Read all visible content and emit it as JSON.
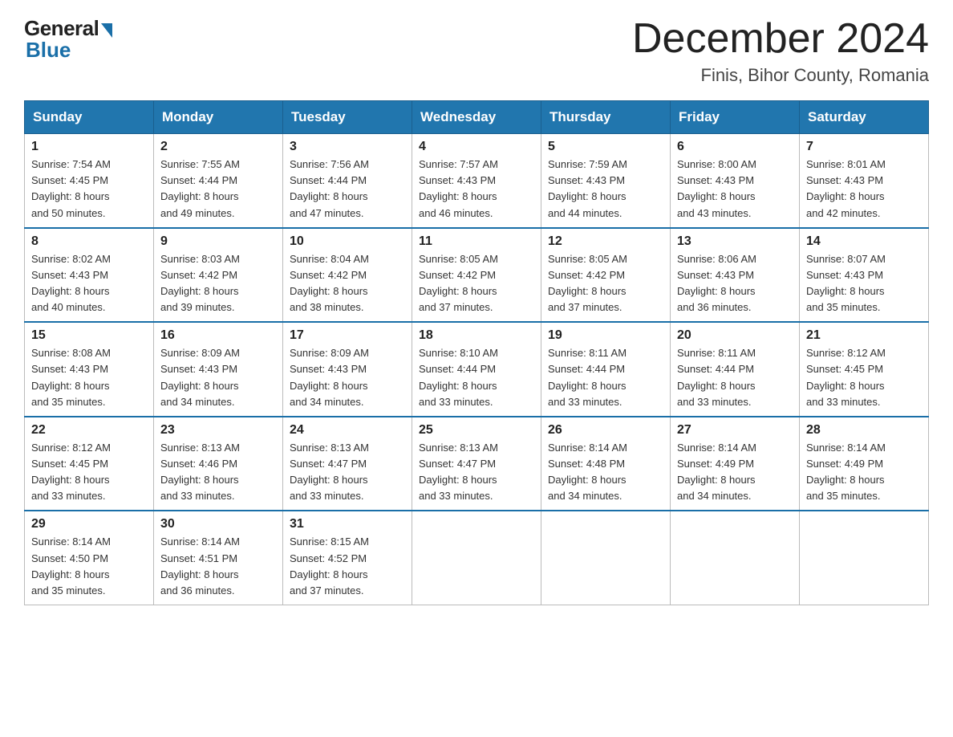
{
  "logo": {
    "general": "General",
    "blue": "Blue"
  },
  "header": {
    "title": "December 2024",
    "location": "Finis, Bihor County, Romania"
  },
  "columns": [
    "Sunday",
    "Monday",
    "Tuesday",
    "Wednesday",
    "Thursday",
    "Friday",
    "Saturday"
  ],
  "weeks": [
    [
      {
        "day": "1",
        "sunrise": "7:54 AM",
        "sunset": "4:45 PM",
        "daylight": "8 hours and 50 minutes."
      },
      {
        "day": "2",
        "sunrise": "7:55 AM",
        "sunset": "4:44 PM",
        "daylight": "8 hours and 49 minutes."
      },
      {
        "day": "3",
        "sunrise": "7:56 AM",
        "sunset": "4:44 PM",
        "daylight": "8 hours and 47 minutes."
      },
      {
        "day": "4",
        "sunrise": "7:57 AM",
        "sunset": "4:43 PM",
        "daylight": "8 hours and 46 minutes."
      },
      {
        "day": "5",
        "sunrise": "7:59 AM",
        "sunset": "4:43 PM",
        "daylight": "8 hours and 44 minutes."
      },
      {
        "day": "6",
        "sunrise": "8:00 AM",
        "sunset": "4:43 PM",
        "daylight": "8 hours and 43 minutes."
      },
      {
        "day": "7",
        "sunrise": "8:01 AM",
        "sunset": "4:43 PM",
        "daylight": "8 hours and 42 minutes."
      }
    ],
    [
      {
        "day": "8",
        "sunrise": "8:02 AM",
        "sunset": "4:43 PM",
        "daylight": "8 hours and 40 minutes."
      },
      {
        "day": "9",
        "sunrise": "8:03 AM",
        "sunset": "4:42 PM",
        "daylight": "8 hours and 39 minutes."
      },
      {
        "day": "10",
        "sunrise": "8:04 AM",
        "sunset": "4:42 PM",
        "daylight": "8 hours and 38 minutes."
      },
      {
        "day": "11",
        "sunrise": "8:05 AM",
        "sunset": "4:42 PM",
        "daylight": "8 hours and 37 minutes."
      },
      {
        "day": "12",
        "sunrise": "8:05 AM",
        "sunset": "4:42 PM",
        "daylight": "8 hours and 37 minutes."
      },
      {
        "day": "13",
        "sunrise": "8:06 AM",
        "sunset": "4:43 PM",
        "daylight": "8 hours and 36 minutes."
      },
      {
        "day": "14",
        "sunrise": "8:07 AM",
        "sunset": "4:43 PM",
        "daylight": "8 hours and 35 minutes."
      }
    ],
    [
      {
        "day": "15",
        "sunrise": "8:08 AM",
        "sunset": "4:43 PM",
        "daylight": "8 hours and 35 minutes."
      },
      {
        "day": "16",
        "sunrise": "8:09 AM",
        "sunset": "4:43 PM",
        "daylight": "8 hours and 34 minutes."
      },
      {
        "day": "17",
        "sunrise": "8:09 AM",
        "sunset": "4:43 PM",
        "daylight": "8 hours and 34 minutes."
      },
      {
        "day": "18",
        "sunrise": "8:10 AM",
        "sunset": "4:44 PM",
        "daylight": "8 hours and 33 minutes."
      },
      {
        "day": "19",
        "sunrise": "8:11 AM",
        "sunset": "4:44 PM",
        "daylight": "8 hours and 33 minutes."
      },
      {
        "day": "20",
        "sunrise": "8:11 AM",
        "sunset": "4:44 PM",
        "daylight": "8 hours and 33 minutes."
      },
      {
        "day": "21",
        "sunrise": "8:12 AM",
        "sunset": "4:45 PM",
        "daylight": "8 hours and 33 minutes."
      }
    ],
    [
      {
        "day": "22",
        "sunrise": "8:12 AM",
        "sunset": "4:45 PM",
        "daylight": "8 hours and 33 minutes."
      },
      {
        "day": "23",
        "sunrise": "8:13 AM",
        "sunset": "4:46 PM",
        "daylight": "8 hours and 33 minutes."
      },
      {
        "day": "24",
        "sunrise": "8:13 AM",
        "sunset": "4:47 PM",
        "daylight": "8 hours and 33 minutes."
      },
      {
        "day": "25",
        "sunrise": "8:13 AM",
        "sunset": "4:47 PM",
        "daylight": "8 hours and 33 minutes."
      },
      {
        "day": "26",
        "sunrise": "8:14 AM",
        "sunset": "4:48 PM",
        "daylight": "8 hours and 34 minutes."
      },
      {
        "day": "27",
        "sunrise": "8:14 AM",
        "sunset": "4:49 PM",
        "daylight": "8 hours and 34 minutes."
      },
      {
        "day": "28",
        "sunrise": "8:14 AM",
        "sunset": "4:49 PM",
        "daylight": "8 hours and 35 minutes."
      }
    ],
    [
      {
        "day": "29",
        "sunrise": "8:14 AM",
        "sunset": "4:50 PM",
        "daylight": "8 hours and 35 minutes."
      },
      {
        "day": "30",
        "sunrise": "8:14 AM",
        "sunset": "4:51 PM",
        "daylight": "8 hours and 36 minutes."
      },
      {
        "day": "31",
        "sunrise": "8:15 AM",
        "sunset": "4:52 PM",
        "daylight": "8 hours and 37 minutes."
      },
      null,
      null,
      null,
      null
    ]
  ],
  "labels": {
    "sunrise": "Sunrise:",
    "sunset": "Sunset:",
    "daylight": "Daylight:"
  }
}
